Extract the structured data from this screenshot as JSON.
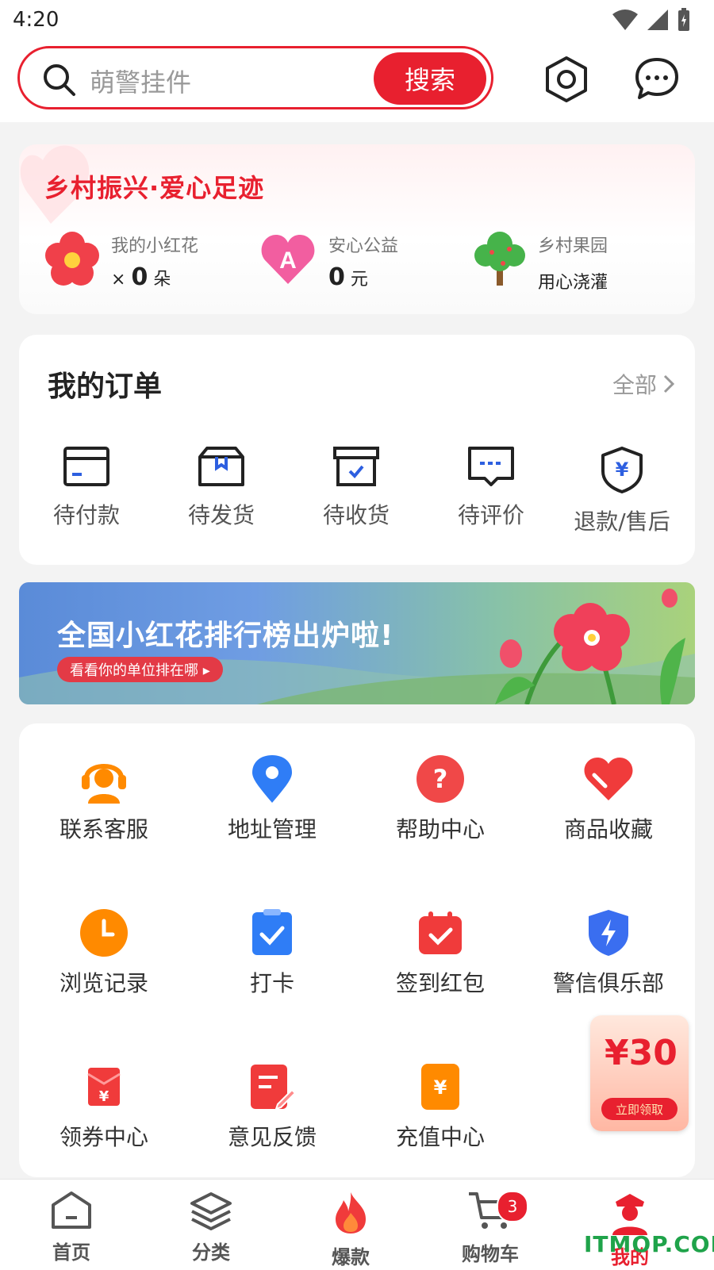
{
  "status_bar": {
    "time": "4:20"
  },
  "search": {
    "placeholder": "萌警挂件",
    "button": "搜索"
  },
  "charity": {
    "title": "乡村振兴·爱心足迹",
    "items": [
      {
        "label": "我的小红花",
        "prefix": "×",
        "value": "0",
        "unit": "朵"
      },
      {
        "label": "安心公益",
        "value": "0",
        "unit": "元"
      },
      {
        "label": "乡村果园",
        "value": "用心浇灌"
      }
    ]
  },
  "orders": {
    "title": "我的订单",
    "all_label": "全部",
    "items": [
      {
        "label": "待付款",
        "icon": "wallet-icon"
      },
      {
        "label": "待发货",
        "icon": "package-icon"
      },
      {
        "label": "待收货",
        "icon": "box-check-icon"
      },
      {
        "label": "待评价",
        "icon": "comment-icon"
      },
      {
        "label": "退款/售后",
        "icon": "shield-yen-icon"
      }
    ]
  },
  "banner": {
    "title": "全国小红花排行榜出炉啦!",
    "subtitle": "看看你的单位排在哪 ▸"
  },
  "services": [
    {
      "label": "联系客服",
      "icon": "headset-icon",
      "color": "#ff8a00"
    },
    {
      "label": "地址管理",
      "icon": "location-pin-icon",
      "color": "#2f7df6"
    },
    {
      "label": "帮助中心",
      "icon": "help-icon",
      "color": "#f04848"
    },
    {
      "label": "商品收藏",
      "icon": "heart-icon",
      "color": "#f03b3b"
    },
    {
      "label": "浏览记录",
      "icon": "clock-icon",
      "color": "#ff8a00"
    },
    {
      "label": "打卡",
      "icon": "checkin-icon",
      "color": "#2f7df6"
    },
    {
      "label": "签到红包",
      "icon": "calendar-check-icon",
      "color": "#f03b3b"
    },
    {
      "label": "警信俱乐部",
      "icon": "shield-bolt-icon",
      "color": "#3a6ef0"
    },
    {
      "label": "领券中心",
      "icon": "coupon-envelope-icon",
      "color": "#f03b3b"
    },
    {
      "label": "意见反馈",
      "icon": "feedback-edit-icon",
      "color": "#f03b3b"
    },
    {
      "label": "充值中心",
      "icon": "recharge-icon",
      "color": "#ff8a00"
    }
  ],
  "coupon": {
    "amount": "¥30",
    "button": "立即领取"
  },
  "bottom_nav": [
    {
      "label": "首页",
      "icon": "home-icon"
    },
    {
      "label": "分类",
      "icon": "layers-icon"
    },
    {
      "label": "爆款",
      "icon": "flame-icon"
    },
    {
      "label": "购物车",
      "icon": "cart-icon",
      "badge": "3"
    },
    {
      "label": "我的",
      "icon": "police-avatar-icon",
      "active": true
    }
  ],
  "watermark": "ITMOP.COM",
  "colors": {
    "brand_red": "#e8202f",
    "accent_blue": "#2f7df6",
    "accent_orange": "#ff8a00"
  }
}
